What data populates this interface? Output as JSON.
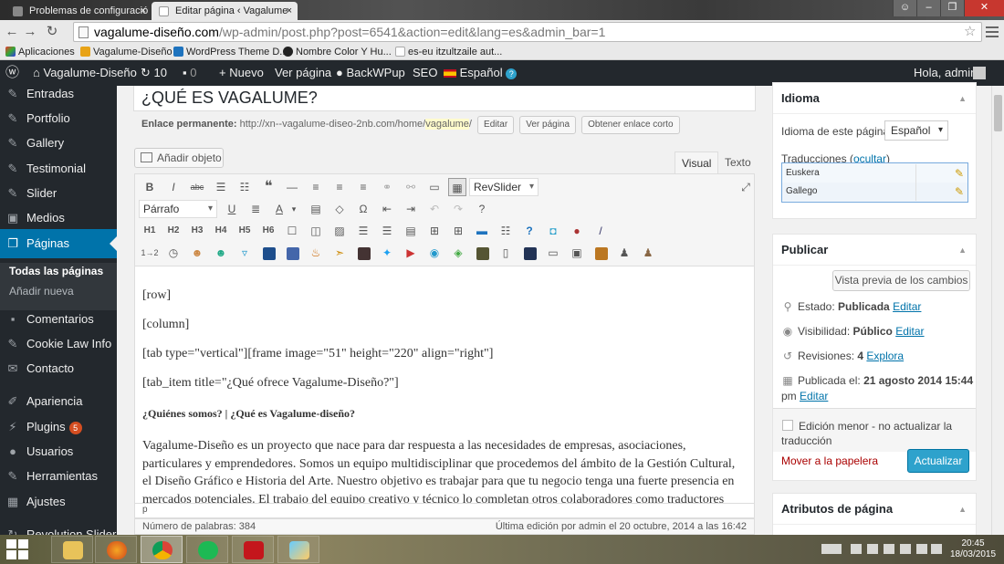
{
  "browser": {
    "tabs": [
      {
        "title": "Problemas de configuració",
        "close": "×"
      },
      {
        "title": "Editar página ‹ Vagalume",
        "close": "×"
      }
    ],
    "url_host": "vagalume-diseño.com",
    "url_path": "/wp-admin/post.php?post=6541&action=edit&lang=es&admin_bar=1",
    "bookmarks": [
      "Aplicaciones",
      "Vagalume-Diseño",
      "WordPress Theme D...",
      "Nombre Color Y Hu...",
      "es-eu itzultzaile aut..."
    ]
  },
  "adminbar": {
    "site": "Vagalume-Diseño",
    "updates": "10",
    "comments": "0",
    "new": "Nuevo",
    "view": "Ver página",
    "backwpup": "BackWPup",
    "seo": "SEO",
    "lang": "Español",
    "greeting": "Hola, admin"
  },
  "sidebar": {
    "items": [
      {
        "label": "Entradas"
      },
      {
        "label": "Portfolio"
      },
      {
        "label": "Gallery"
      },
      {
        "label": "Testimonial"
      },
      {
        "label": "Slider"
      },
      {
        "label": "Medios"
      },
      {
        "label": "Páginas"
      },
      {
        "label": "Comentarios"
      },
      {
        "label": "Cookie Law Info"
      },
      {
        "label": "Contacto"
      },
      {
        "label": "Apariencia"
      },
      {
        "label": "Plugins",
        "badge": "5"
      },
      {
        "label": "Usuarios"
      },
      {
        "label": "Herramientas"
      },
      {
        "label": "Ajustes"
      },
      {
        "label": "Revolution Slider"
      }
    ],
    "submenu": [
      "Todas las páginas",
      "Añadir nueva"
    ]
  },
  "editor": {
    "title": "¿QUÉ ES VAGALUME?",
    "permalink_label": "Enlace permanente:",
    "permalink_base": "http://xn--vagalume-diseo-2nb.com/home/",
    "permalink_slug": "vagalume",
    "permalink_end": "/",
    "btn_edit": "Editar",
    "btn_view": "Ver página",
    "btn_shortlink": "Obtener enlace corto",
    "add_media": "Añadir objeto",
    "tab_visual": "Visual",
    "tab_text": "Texto",
    "format_select": "Párrafo",
    "revslider": "RevSlider",
    "headings": [
      "H1",
      "H2",
      "H3",
      "H4",
      "H5",
      "H6"
    ],
    "counter": "1→2",
    "lines": [
      "[row]",
      "[column]",
      "[tab type=\"vertical\"][frame image=\"51\" height=\"220\" align=\"right\"]",
      "[tab_item title=\"¿Qué ofrece Vagalume-Diseño?\"]",
      "¿Quiénes somos? | ¿Qué es Vagalume-diseño?",
      "Vagalume-Diseño es un proyecto que nace para dar respuesta a las necesidades de empresas, asociaciones, particulares y emprendedores. Somos un equipo multidisciplinar que procedemos del ámbito de la Gestión Cultural, el Diseño Gráfico e Historia del Arte. Nuestro objetivo es trabajar para que tu negocio tenga una fuerte presencia en mercados potenciales. El trabajo del equipo creativo y técnico lo completan otros colaboradores como traductores"
    ],
    "path": "p",
    "wordcount": "Número de palabras: 384",
    "lastedit": "Última edición por admin el 20 octubre, 2014 a las 16:42"
  },
  "idioma": {
    "title": "Idioma",
    "label": "Idioma de este página",
    "value": "Español",
    "translations_label": "Traducciones",
    "hide_link": "ocultar",
    "translations": [
      "Euskera",
      "Gallego"
    ]
  },
  "publicar": {
    "title": "Publicar",
    "preview": "Vista previa de los cambios",
    "status_label": "Estado:",
    "status_value": "Publicada",
    "visibility_label": "Visibilidad:",
    "visibility_value": "Público",
    "revisions_label": "Revisiones:",
    "revisions_value": "4",
    "explore": "Explora",
    "published_label": "Publicada el:",
    "published_value": "21 agosto 2014 15:44",
    "published_cont": "pm",
    "edit": "Editar",
    "minor_edit_1": "Edición menor - no actualizar la",
    "minor_edit_2": "traducción",
    "trash": "Mover a la papelera",
    "update": "Actualizar"
  },
  "atributos": {
    "title": "Atributos de página"
  },
  "taskbar": {
    "time": "20:45",
    "date": "18/03/2015"
  },
  "colors": {
    "accent": "#0073aa",
    "adminbar": "#23282d",
    "button_primary": "#2ea2cc",
    "trash": "#a00"
  }
}
